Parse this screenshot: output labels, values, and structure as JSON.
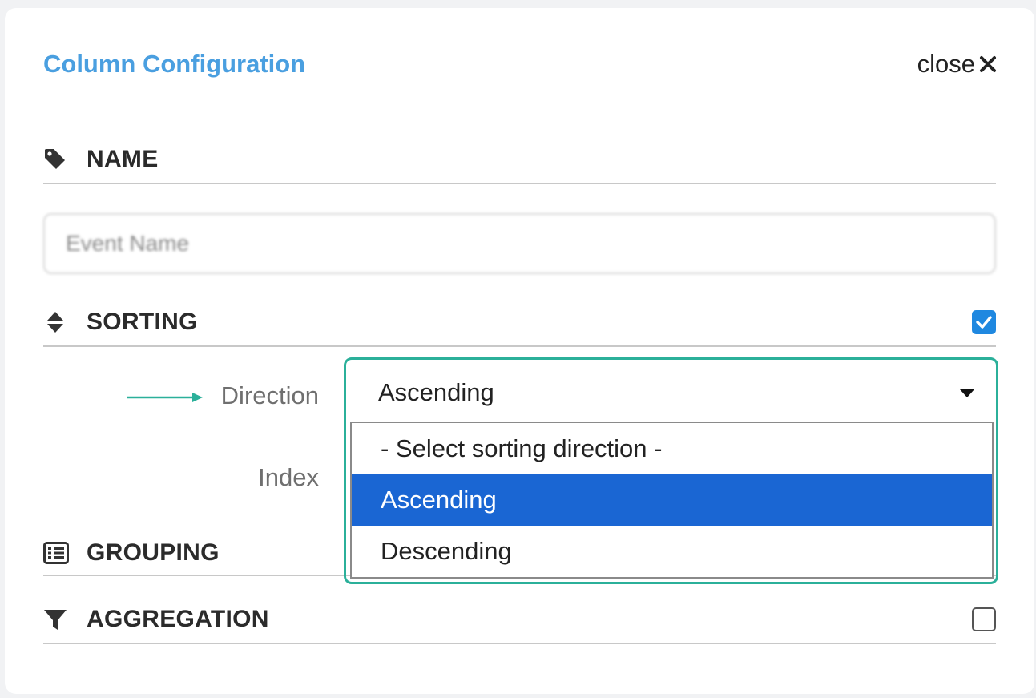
{
  "panel": {
    "title": "Column Configuration",
    "close_label": "close",
    "close_icon": "close-icon"
  },
  "sections": {
    "name": {
      "label": "NAME",
      "icon": "tag-icon"
    },
    "sorting": {
      "label": "SORTING",
      "icon": "sort-icon",
      "checked": true
    },
    "grouping": {
      "label": "GROUPING",
      "icon": "list-icon"
    },
    "aggregation": {
      "label": "AGGREGATION",
      "icon": "filter-icon",
      "checked": false
    }
  },
  "name_field": {
    "value": "Event Name",
    "blurred": true
  },
  "sorting_fields": {
    "direction_label": "Direction",
    "index_label": "Index",
    "direction_value": "Ascending",
    "options": [
      {
        "label": "- Select sorting direction -",
        "selected": false
      },
      {
        "label": "Ascending",
        "selected": true
      },
      {
        "label": "Descending",
        "selected": false
      }
    ]
  },
  "colors": {
    "title": "#4a9fe0",
    "checkbox_checked": "#1f88e0",
    "option_selected": "#1a66d3",
    "annotation": "#2bb09a"
  }
}
